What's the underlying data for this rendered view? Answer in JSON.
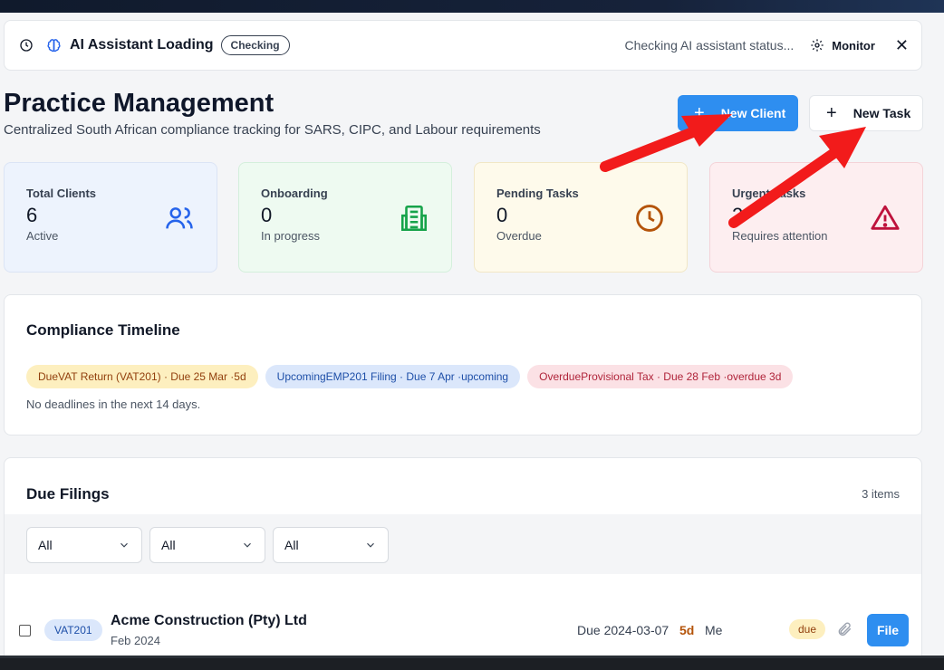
{
  "ai_bar": {
    "title": "AI Assistant Loading",
    "badge": "Checking",
    "status": "Checking AI assistant status...",
    "monitor_label": "Monitor",
    "close_label": "✕"
  },
  "page": {
    "title": "Practice Management",
    "subtitle": "Centralized South African compliance tracking for SARS, CIPC, and Labour requirements"
  },
  "actions": {
    "new_client": "New Client",
    "new_task": "New Task",
    "plus": "+"
  },
  "stats": [
    {
      "label": "Total Clients",
      "value": "6",
      "sub": "Active",
      "icon": "users-icon",
      "color": "#2563eb"
    },
    {
      "label": "Onboarding",
      "value": "0",
      "sub": "In progress",
      "icon": "building-icon",
      "color": "#16a34a"
    },
    {
      "label": "Pending Tasks",
      "value": "0",
      "sub": "Overdue",
      "icon": "clock-icon",
      "color": "#b45309"
    },
    {
      "label": "Urgent Tasks",
      "value": "2",
      "sub": "Requires attention",
      "icon": "warning-icon",
      "color": "#be123c"
    }
  ],
  "timeline": {
    "title": "Compliance Timeline",
    "chips": [
      "DueVAT Return (VAT201) · Due 25 Mar ·5d",
      "UpcomingEMP201 Filing · Due 7 Apr ·upcoming",
      "OverdueProvisional Tax · Due 28 Feb ·overdue 3d"
    ],
    "empty_text": "No deadlines in the next 14 days."
  },
  "filings": {
    "title": "Due Filings",
    "count": "3 items",
    "filters": [
      "All",
      "All",
      "All"
    ],
    "rows": [
      {
        "type": "VAT201",
        "client": "Acme Construction (Pty) Ltd",
        "period": "Feb 2024",
        "due": "Due 2024-03-07",
        "days": "5d",
        "assignee": "Me",
        "status": "due",
        "action": "File"
      }
    ]
  },
  "colors": {
    "primary": "#2e8ef0",
    "annotation_arrow": "#f21b1b"
  }
}
